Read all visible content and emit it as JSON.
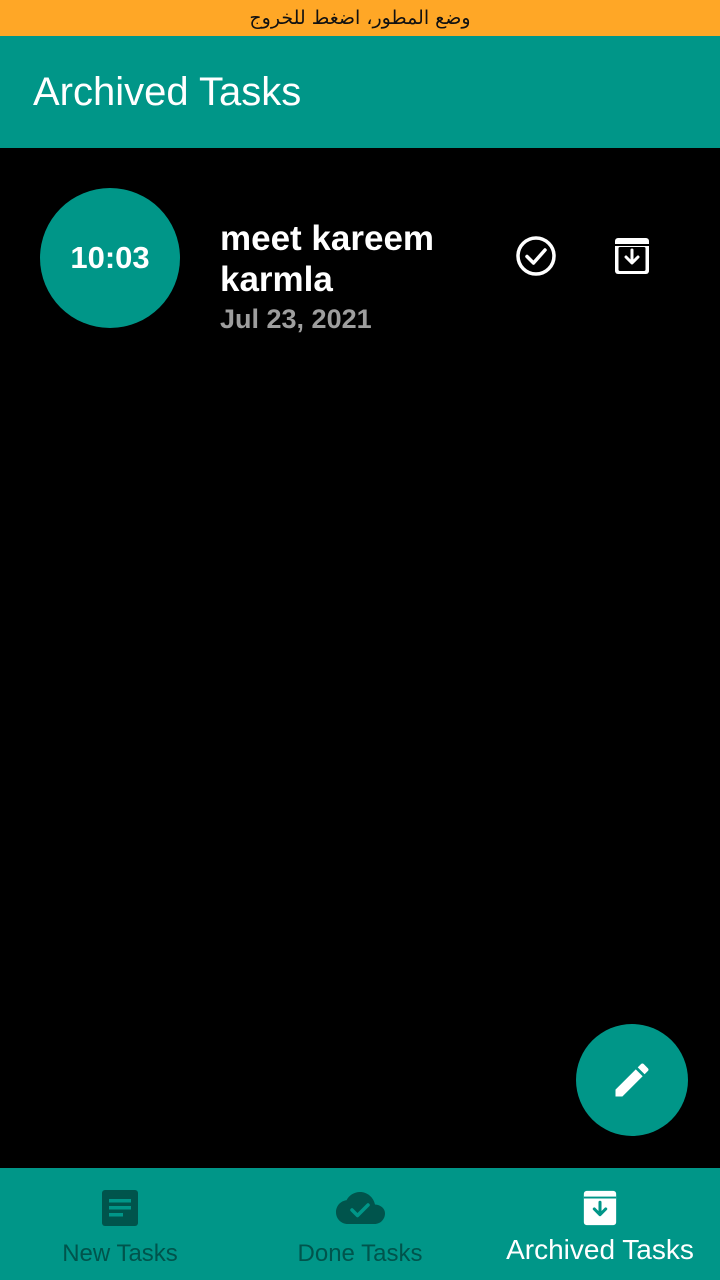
{
  "dev_banner": {
    "text": "وضع المطور، اضغط للخروج"
  },
  "appbar": {
    "title": "Archived Tasks"
  },
  "tasks": [
    {
      "time": "10:03",
      "title": "meet kareem karmla",
      "date": "Jul 23, 2021"
    }
  ],
  "bottom_nav": {
    "items": [
      {
        "label": "New Tasks",
        "icon": "notes-icon",
        "active": false
      },
      {
        "label": "Done Tasks",
        "icon": "cloud-done-icon",
        "active": false
      },
      {
        "label": "Archived Tasks",
        "icon": "archive-icon",
        "active": true
      }
    ]
  },
  "colors": {
    "primary": "#009688",
    "banner": "#FFA726",
    "background": "#000000"
  }
}
